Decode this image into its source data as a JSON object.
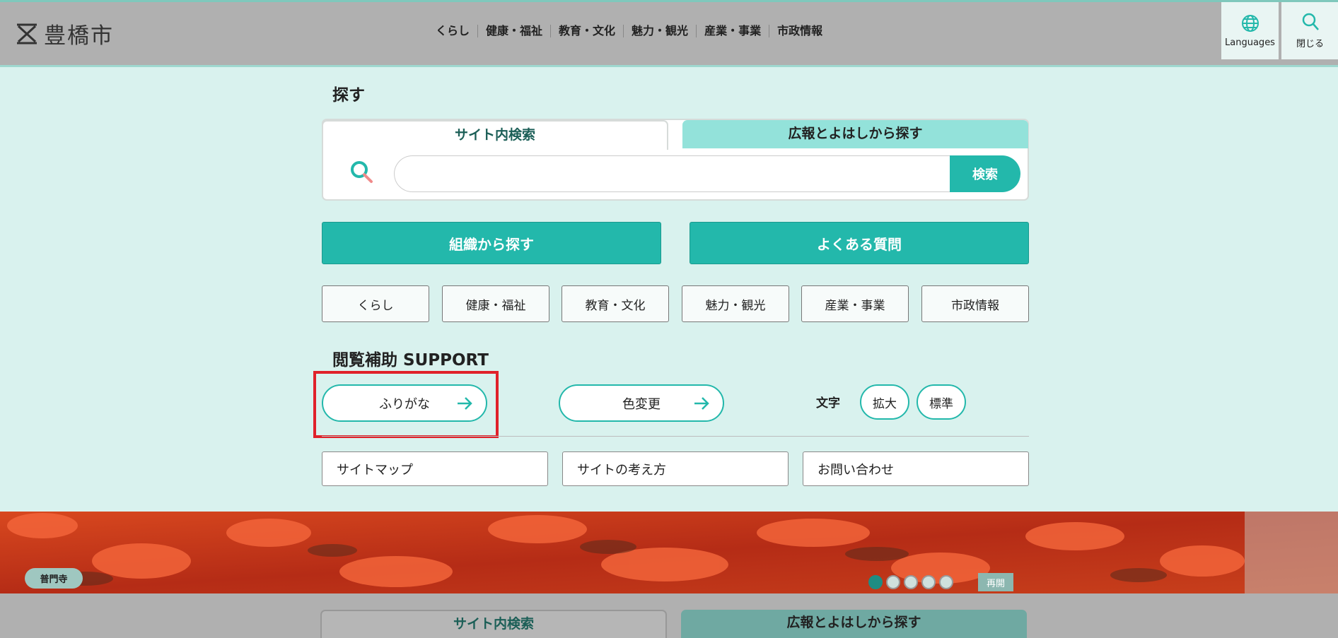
{
  "header": {
    "logo_text": "豊橋市",
    "nav": [
      "くらし",
      "健康・福祉",
      "教育・文化",
      "魅力・観光",
      "産業・事業",
      "市政情報"
    ],
    "languages_label": "Languages",
    "close_label": "閉じる"
  },
  "search": {
    "section_title": "探す",
    "tab_site": "サイト内検索",
    "tab_kouhou": "広報とよはしから探す",
    "input_value": "",
    "submit_label": "検索"
  },
  "big_buttons": {
    "org": "組織から探す",
    "faq": "よくある質問"
  },
  "categories": [
    "くらし",
    "健康・福祉",
    "教育・文化",
    "魅力・観光",
    "産業・事業",
    "市政情報"
  ],
  "support": {
    "title": "閲覧補助 SUPPORT",
    "furigana": "ふりがな",
    "color_change": "色変更",
    "text_label": "文字",
    "enlarge": "拡大",
    "standard": "標準"
  },
  "links": [
    "サイトマップ",
    "サイトの考え方",
    "お問い合わせ"
  ],
  "banner": {
    "place": "普門寺",
    "replay": "再開",
    "slide_count": 5,
    "active_slide": 1
  },
  "bottom": {
    "tab_site": "サイト内検索",
    "tab_kouhou": "広報とよはしから探す"
  },
  "colors": {
    "accent": "#23b8ab",
    "background": "#d9f2ee",
    "header": "#b0b0b0",
    "highlight": "#e0222a"
  }
}
